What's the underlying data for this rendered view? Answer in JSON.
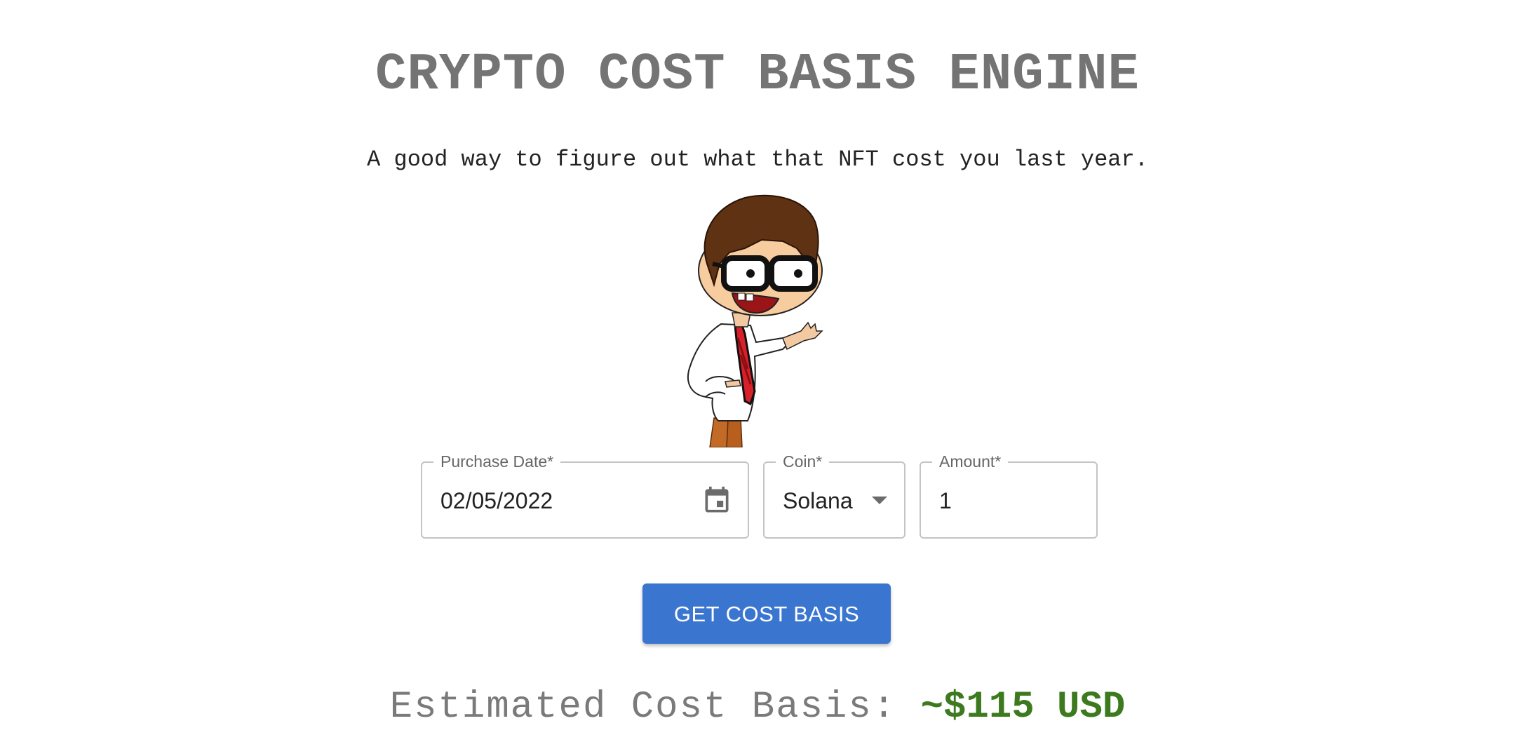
{
  "header": {
    "title": "CRYPTO COST BASIS ENGINE",
    "subtitle": "A good way to figure out what that NFT cost you last year."
  },
  "form": {
    "purchase_date": {
      "label": "Purchase Date*",
      "value": "02/05/2022",
      "icon": "calendar-icon"
    },
    "coin": {
      "label": "Coin*",
      "value": "Solana",
      "icon": "chevron-down-icon"
    },
    "amount": {
      "label": "Amount*",
      "value": "1"
    },
    "submit_label": "GET COST BASIS"
  },
  "result": {
    "label": "Estimated Cost Basis: ",
    "value": "~$115 USD"
  },
  "colors": {
    "accent": "#3a76d0",
    "result_value": "#3d7a1f",
    "title": "#747474"
  }
}
